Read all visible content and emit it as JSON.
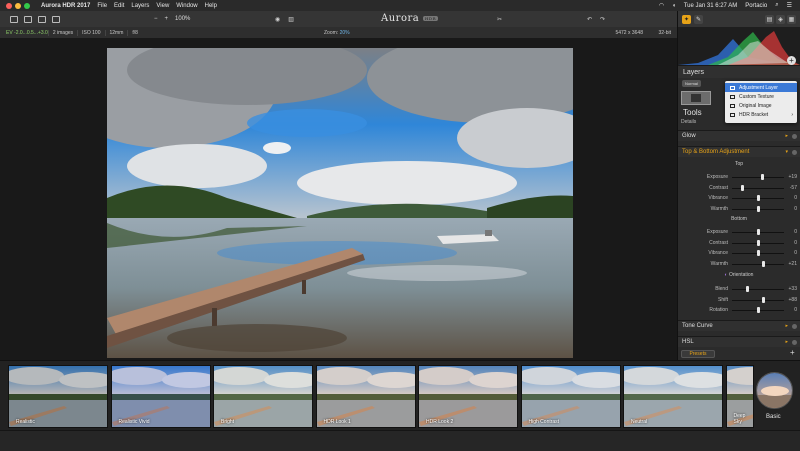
{
  "menubar": {
    "app_name": "Aurora HDR 2017",
    "menus": [
      "File",
      "Edit",
      "Layers",
      "View",
      "Window",
      "Help"
    ],
    "clock": "Tue Jan 31  6:27 AM",
    "user": "Portacio",
    "traffic_colors": [
      "#fc605c",
      "#fdbc40",
      "#34c84a"
    ]
  },
  "toolbar": {
    "zoom_minus": "−",
    "zoom_plus": "+",
    "zoom_percent": "100%",
    "logo": "Aurora",
    "logo_badge": "HDR",
    "accent": "#e7a318"
  },
  "info": {
    "ev": "EV  -2.0...0.5...+3.0",
    "images": "2 images",
    "iso": "ISO 100",
    "focal": "12mm",
    "aperture": "f/8",
    "zoom_label": "Zoom:",
    "zoom_value": "20%",
    "dims": "5472 x 3648",
    "bits": "32-bit"
  },
  "panel": {
    "layers_title": "Layers",
    "blend_mode": "Normal",
    "dropdown": [
      "Adjustment Layer",
      "Custom Texture",
      "Original Image",
      "HDR Bracket"
    ],
    "tools_title": "Tools",
    "details_label": "Details",
    "glow": "Glow",
    "top_bottom": "Top & Bottom Adjustment",
    "top_head": "Top",
    "bottom_head": "Bottom",
    "orientation": "Orientation",
    "top_sliders": [
      {
        "label": "Exposure",
        "value": "+19",
        "pos": 0.58
      },
      {
        "label": "Contrast",
        "value": "-57",
        "pos": 0.2
      },
      {
        "label": "Vibrance",
        "value": "0",
        "pos": 0.5
      },
      {
        "label": "Warmth",
        "value": "0",
        "pos": 0.5
      }
    ],
    "bottom_sliders": [
      {
        "label": "Exposure",
        "value": "0",
        "pos": 0.5
      },
      {
        "label": "Contrast",
        "value": "0",
        "pos": 0.5
      },
      {
        "label": "Vibrance",
        "value": "0",
        "pos": 0.5
      },
      {
        "label": "Warmth",
        "value": "+21",
        "pos": 0.6
      }
    ],
    "orientation_sliders": [
      {
        "label": "Blend",
        "value": "+33",
        "pos": 0.3
      },
      {
        "label": "Shift",
        "value": "+88",
        "pos": 0.6
      },
      {
        "label": "Rotation",
        "value": "0",
        "pos": 0.5
      }
    ],
    "tone_curve": "Tone Curve",
    "hsl": "HSL",
    "presets": "Presets"
  },
  "strip": {
    "thumbs": [
      "Realistic",
      "Realistic Vivid",
      "Bright",
      "HDR Look 1",
      "HDR Look 2",
      "High Contrast",
      "Neutral",
      "Deep Sky"
    ],
    "basic_label": "Basic"
  }
}
